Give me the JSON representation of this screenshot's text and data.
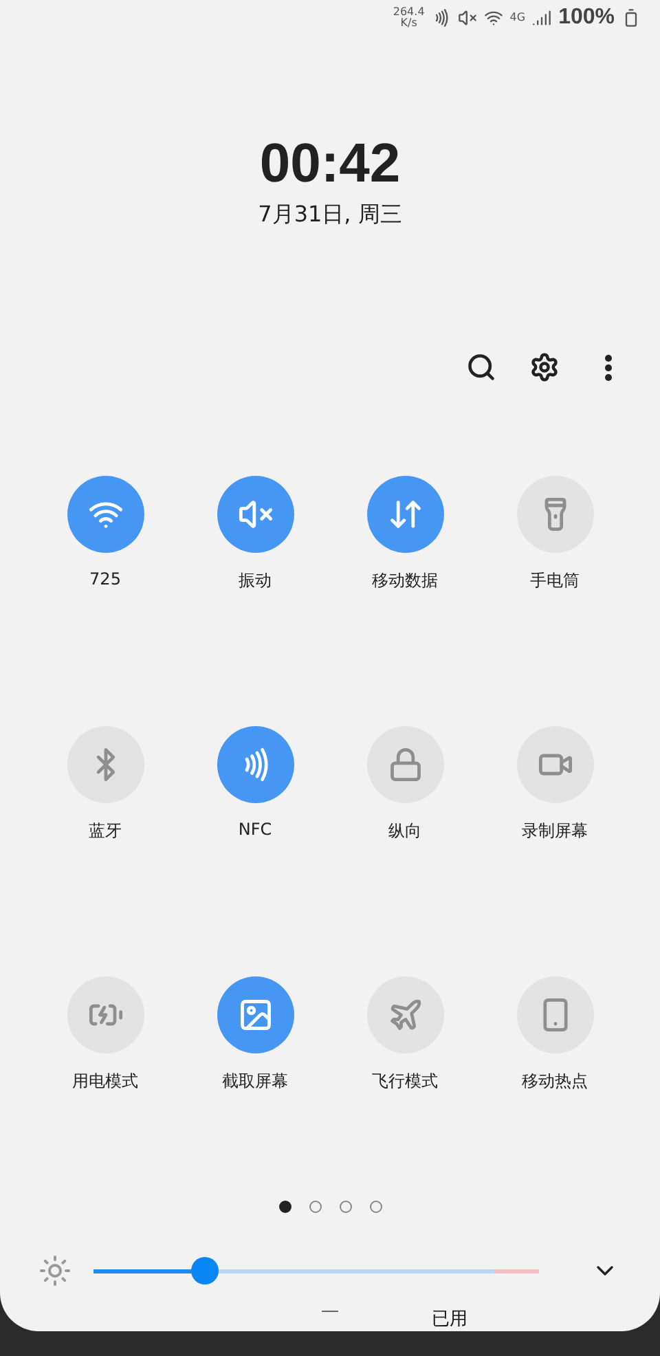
{
  "status_bar": {
    "speed": "264.4",
    "speed_unit": "K/s",
    "network": "4G",
    "battery": "100%"
  },
  "clock": {
    "time": "00:42",
    "date": "7月31日, 周三"
  },
  "tiles": [
    {
      "kind": "wifi",
      "label": "725",
      "on": true
    },
    {
      "kind": "vibrate",
      "label": "振动",
      "on": true
    },
    {
      "kind": "data",
      "label": "移动数据",
      "on": true
    },
    {
      "kind": "flashlight",
      "label": "手电筒",
      "on": false
    },
    {
      "kind": "bluetooth",
      "label": "蓝牙",
      "on": false
    },
    {
      "kind": "nfc",
      "label": "NFC",
      "on": true
    },
    {
      "kind": "portrait",
      "label": "纵向",
      "on": false
    },
    {
      "kind": "record",
      "label": "录制屏幕",
      "on": false
    },
    {
      "kind": "power",
      "label": "用电模式",
      "on": false
    },
    {
      "kind": "screenshot",
      "label": "截取屏幕",
      "on": true
    },
    {
      "kind": "airplane",
      "label": "飞行模式",
      "on": false
    },
    {
      "kind": "hotspot",
      "label": "移动热点",
      "on": false
    }
  ],
  "pages": [
    {
      "selected": true
    },
    {
      "selected": false
    },
    {
      "selected": false
    },
    {
      "selected": false
    }
  ],
  "brightness": {
    "level": 0.25
  },
  "storage": "已用"
}
